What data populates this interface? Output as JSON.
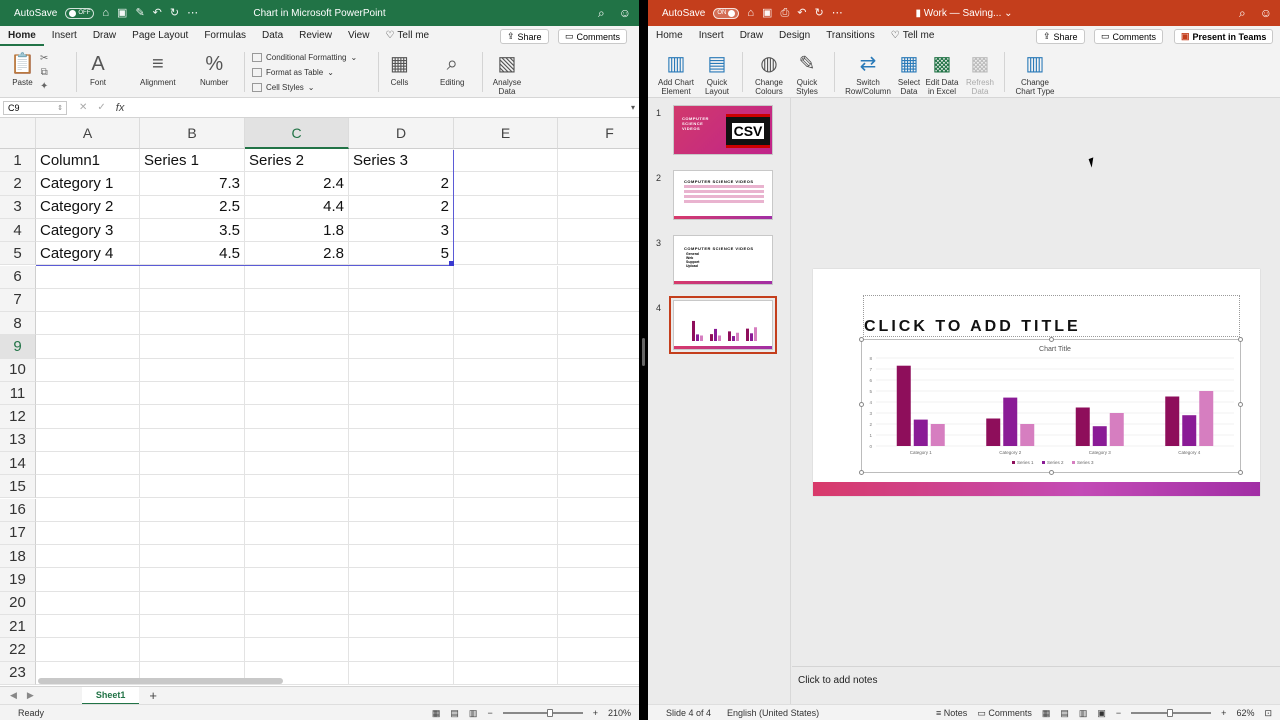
{
  "excel": {
    "autosave_label": "AutoSave",
    "autosave_state": "OFF",
    "window_title": "Chart in Microsoft PowerPoint",
    "tabs": [
      "Home",
      "Insert",
      "Draw",
      "Page Layout",
      "Formulas",
      "Data",
      "Review",
      "View"
    ],
    "tell_me": "Tell me",
    "share": "Share",
    "comments": "Comments",
    "ribbon": {
      "paste": "Paste",
      "font": "Font",
      "alignment": "Alignment",
      "number": "Number",
      "conditional_formatting": "Conditional Formatting",
      "format_as_table": "Format as Table",
      "cell_styles": "Cell Styles",
      "cells": "Cells",
      "editing": "Editing",
      "analyse_data": "Analyse Data"
    },
    "name_box": "C9",
    "fx": "fx",
    "column_headers": [
      "A",
      "B",
      "C",
      "D",
      "E",
      "F"
    ],
    "selected_column": "C",
    "row_numbers": [
      "1",
      "2",
      "3",
      "4",
      "5",
      "6",
      "7",
      "8",
      "9",
      "10",
      "11",
      "12",
      "13",
      "14",
      "15",
      "16",
      "17",
      "18",
      "19",
      "20",
      "21",
      "22",
      "23"
    ],
    "selected_row": "9",
    "table": [
      [
        "Column1",
        "Series 1",
        "Series 2",
        "Series 3"
      ],
      [
        "Category 1",
        "7.3",
        "2.4",
        "2"
      ],
      [
        "Category 2",
        "2.5",
        "4.4",
        "2"
      ],
      [
        "Category 3",
        "3.5",
        "1.8",
        "3"
      ],
      [
        "Category 4",
        "4.5",
        "2.8",
        "5"
      ]
    ],
    "sheet_tab": "Sheet1",
    "add_sheet": "+",
    "status": "Ready",
    "zoom": "210%",
    "accent": "#217346"
  },
  "ppt": {
    "autosave_label": "AutoSave",
    "autosave_state": "ON",
    "window_title": "Work — Saving...",
    "tabs": [
      "Home",
      "Insert",
      "Draw",
      "Design",
      "Transitions"
    ],
    "tell_me": "Tell me",
    "share": "Share",
    "comments": "Comments",
    "present_in_teams": "Present in Teams",
    "ribbon": {
      "add_chart_element": "Add Chart Element",
      "quick_layout": "Quick Layout",
      "change_colours": "Change Colours",
      "quick_styles": "Quick Styles",
      "switch_row_column": "Switch Row/Column",
      "select_data": "Select Data",
      "edit_data_in_excel": "Edit Data in Excel",
      "refresh_data": "Refresh Data",
      "change_chart_type": "Change Chart Type"
    },
    "thumbnails": [
      {
        "num": "1",
        "heading": "COMPUTER SCIENCE VIDEOS",
        "badge": "CSV"
      },
      {
        "num": "2",
        "heading": "COMPUTER SCIENCE VIDEOS"
      },
      {
        "num": "3",
        "heading": "COMPUTER SCIENCE VIDEOS",
        "bullets": [
          "General",
          "Web",
          "Support",
          "Upload"
        ]
      },
      {
        "num": "4"
      }
    ],
    "slide_title_placeholder": "CLICK TO ADD TITLE",
    "notes_placeholder": "Click to add notes",
    "status_slide": "Slide 4 of 4",
    "status_language": "English (United States)",
    "status_notes": "Notes",
    "status_comments": "Comments",
    "zoom": "62%",
    "accent": "#c43e1c"
  },
  "chart_data": {
    "type": "bar",
    "title": "Chart Title",
    "categories": [
      "Category 1",
      "Category 2",
      "Category 3",
      "Category 4"
    ],
    "series": [
      {
        "name": "Series 1",
        "values": [
          7.3,
          2.5,
          3.5,
          4.5
        ],
        "color": "#8e0e5b"
      },
      {
        "name": "Series 2",
        "values": [
          2.4,
          4.4,
          1.8,
          2.8
        ],
        "color": "#8a1b96"
      },
      {
        "name": "Series 3",
        "values": [
          2,
          2,
          3,
          5
        ],
        "color": "#d67ec0"
      }
    ],
    "ylim": [
      0,
      8
    ],
    "yticks": [
      "0",
      "1",
      "2",
      "3",
      "4",
      "5",
      "6",
      "7",
      "8"
    ],
    "grid": true,
    "legend": "bottom"
  }
}
